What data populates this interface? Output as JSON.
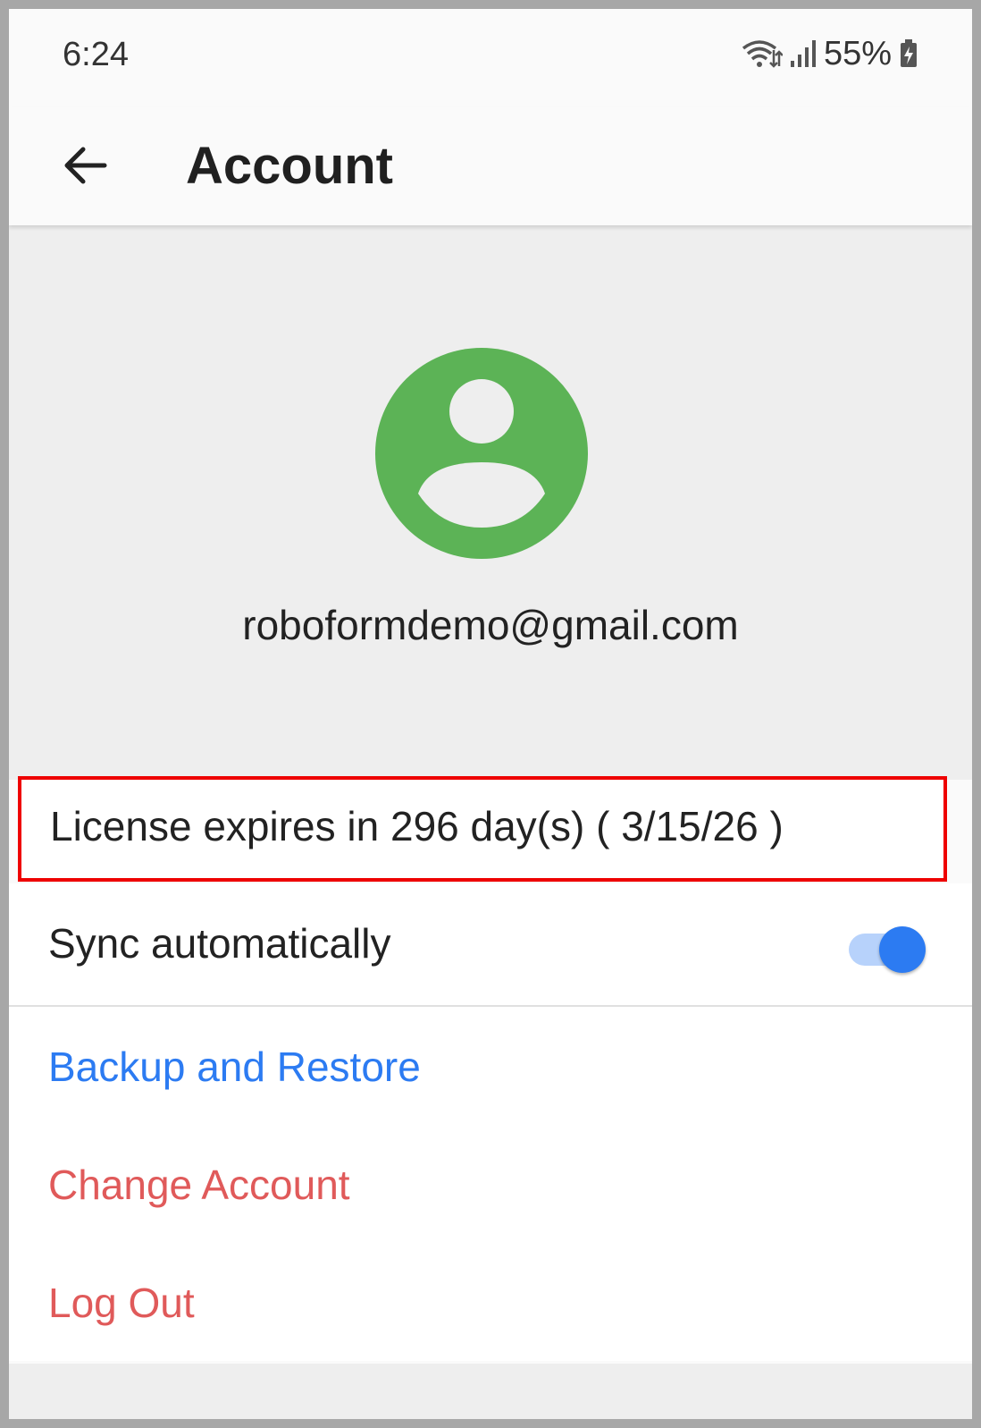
{
  "status_bar": {
    "time": "6:24",
    "battery": "55%",
    "icons": [
      "wifi-data-icon",
      "cell-signal-icon",
      "battery-charging-icon"
    ]
  },
  "app_bar": {
    "title": "Account",
    "back_icon": "arrow-left-icon"
  },
  "profile": {
    "avatar_icon": "account-circle-icon",
    "avatar_color": "#5cb356",
    "email": "roboformdemo@gmail.com"
  },
  "license": {
    "text": "License expires in 296 day(s) ( 3/15/26 )",
    "highlight_color": "#ee0000"
  },
  "settings": {
    "sync_label": "Sync automatically",
    "sync_enabled": true,
    "accent_color": "#2c7bf2"
  },
  "actions": {
    "backup_restore": "Backup and Restore",
    "change_account": "Change Account",
    "log_out": "Log Out",
    "danger_color": "#e05a5a"
  }
}
